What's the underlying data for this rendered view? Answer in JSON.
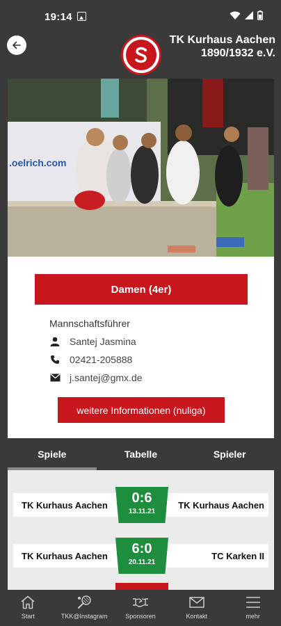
{
  "status_bar": {
    "time": "19:14"
  },
  "header": {
    "back_icon": "arrow-left-icon",
    "club_name_line1": "TK Kurhaus Aachen",
    "club_name_line2": "1890/1932 e.V.",
    "logo": "club-logo"
  },
  "team": {
    "name": "Damen (4er)",
    "captain_label": "Mannschaftsführer",
    "captain_name": "Santej Jasmina",
    "phone": "02421-205888",
    "email": "j.santej@gmx.de",
    "more_info_label": "weitere Informationen (nuliga)"
  },
  "tabs": [
    {
      "label": "Spiele",
      "active": true
    },
    {
      "label": "Tabelle",
      "active": false
    },
    {
      "label": "Spieler",
      "active": false
    }
  ],
  "matches": [
    {
      "home": "TK Kurhaus Aachen",
      "away": "TK Kurhaus Aachen",
      "score": "0:6",
      "date": "13.11.21"
    },
    {
      "home": "TK Kurhaus Aachen",
      "away": "TC Karken II",
      "score": "6:0",
      "date": "20.11.21"
    }
  ],
  "bottom_nav": [
    {
      "label": "Start",
      "icon": "home-icon"
    },
    {
      "label": "TKK@Instagram",
      "icon": "tennis-racket-icon"
    },
    {
      "label": "Sponsoren",
      "icon": "handshake-icon"
    },
    {
      "label": "Kontakt",
      "icon": "mail-icon"
    },
    {
      "label": "mehr",
      "icon": "menu-icon"
    }
  ],
  "colors": {
    "accent_red": "#c8161d",
    "win_green": "#1e8e3e",
    "bar_dark": "#3a3a3a"
  }
}
